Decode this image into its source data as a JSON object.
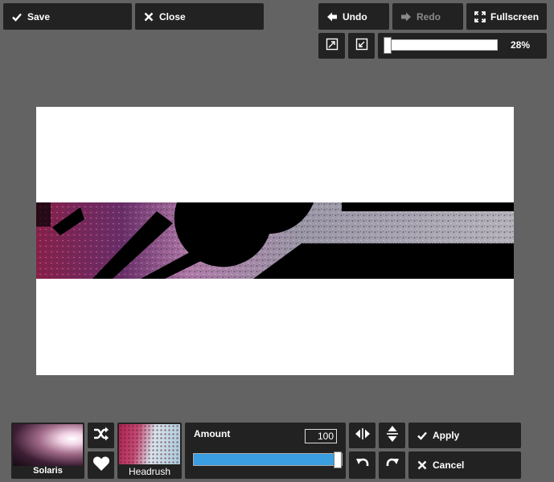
{
  "toolbar": {
    "save_label": "Save",
    "close_label": "Close",
    "undo_label": "Undo",
    "redo_label": "Redo",
    "fullscreen_label": "Fullscreen"
  },
  "zoom": {
    "value_label": "28%",
    "value": 0.28
  },
  "filters": {
    "current": {
      "name": "Solaris"
    },
    "next": {
      "name": "Headrush"
    }
  },
  "amount": {
    "label": "Amount",
    "value": "100",
    "fraction": 1.0
  },
  "actions": {
    "apply_label": "Apply",
    "cancel_label": "Cancel"
  },
  "icons": [
    "check-icon",
    "close-icon",
    "undo-arrow-icon",
    "redo-arrow-icon",
    "fullscreen-icon",
    "zoom-in-icon",
    "zoom-fit-icon",
    "shuffle-icon",
    "heart-icon",
    "flip-horizontal-icon",
    "flip-vertical-icon",
    "rotate-left-icon",
    "rotate-right-icon"
  ],
  "colors": {
    "accent": "#3a9ee0",
    "panel": "#222222",
    "background": "#636363"
  }
}
